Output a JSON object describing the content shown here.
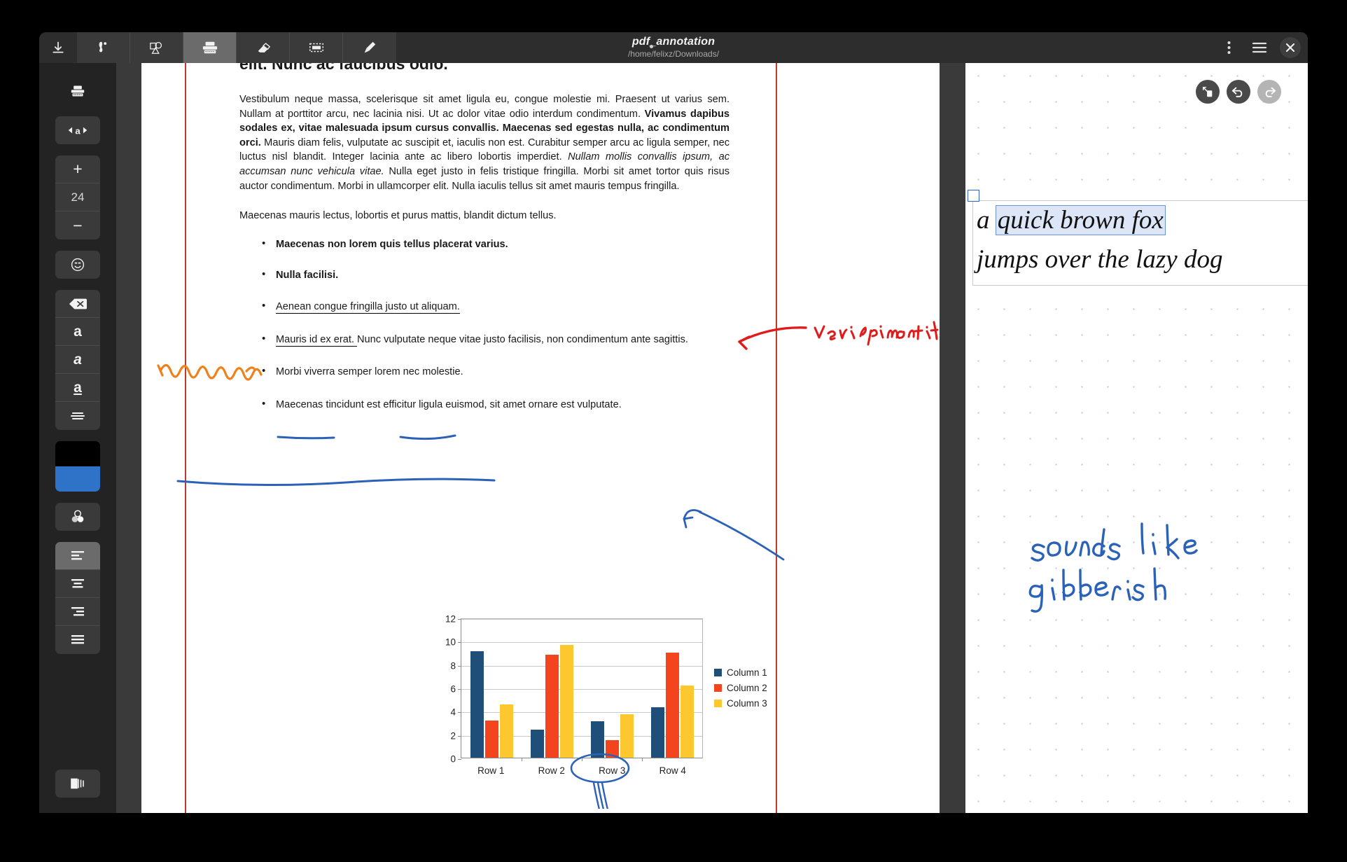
{
  "window": {
    "title": "pdf_annotation",
    "path": "/home/felixz/Downloads/",
    "modified_dot": "•"
  },
  "titlebar": {
    "download_icon": "download-icon",
    "tools": [
      {
        "name": "pen-tool",
        "icon": "pen-icon",
        "active": false
      },
      {
        "name": "shape-tool",
        "icon": "shape-icon",
        "active": false
      },
      {
        "name": "typewriter-tool",
        "icon": "typewriter-icon",
        "active": true
      },
      {
        "name": "eraser-tool",
        "icon": "eraser-icon",
        "active": false
      },
      {
        "name": "select-tool",
        "icon": "marquee-icon",
        "active": false
      },
      {
        "name": "highlighter-tool",
        "icon": "highlighter-icon",
        "active": false
      }
    ],
    "kebab_icon": "kebab-menu-icon",
    "hamburger_icon": "hamburger-menu-icon",
    "close_icon": "close-icon"
  },
  "sidebar": {
    "tool_icon": "typewriter-icon",
    "text_width_icon": "text-width-icon",
    "font_size": {
      "increase_label": "+",
      "value": "24",
      "decrease_label": "−"
    },
    "emoji_icon": "emoji-icon",
    "styles": [
      {
        "name": "clear-format",
        "icon": "backspace-icon",
        "label": ""
      },
      {
        "name": "bold",
        "icon": "bold-a-icon",
        "label": "a"
      },
      {
        "name": "italic",
        "icon": "italic-a-icon",
        "label": "a"
      },
      {
        "name": "underline",
        "icon": "underline-a-icon",
        "label": "a"
      },
      {
        "name": "strikethrough",
        "icon": "strikethrough-icon",
        "label": ""
      }
    ],
    "colors": {
      "primary": "#000000",
      "secondary": "#2f73c8"
    },
    "color_picker_icon": "color-circles-icon",
    "align": [
      {
        "name": "align-left",
        "icon": "align-left-icon",
        "active": true
      },
      {
        "name": "align-center",
        "icon": "align-center-icon",
        "active": false
      },
      {
        "name": "align-right",
        "icon": "align-right-icon",
        "active": false
      },
      {
        "name": "align-justify",
        "icon": "align-justify-icon",
        "active": false
      }
    ],
    "bottom_icon": "page-layout-icon"
  },
  "document": {
    "heading": "elit. Nunc ac faucibus odio.",
    "paragraph1_a": "Vestibulum neque massa, scelerisque sit amet ligula eu, congue molestie mi. Praesent ut varius sem. Nullam at porttitor arcu, nec lacinia nisi. Ut ac dolor vitae odio interdum condimentum. ",
    "paragraph1_bold": "Vivamus dapibus sodales ex, vitae malesuada ipsum cursus convallis. Maecenas sed egestas nulla, ac condimentum orci.",
    "paragraph1_b": " Mauris diam felis, vulputate ac suscipit et, iaculis non est. Curabitur semper arcu ac ligula semper, nec luctus nisl blandit. Integer lacinia ante ac libero lobortis imperdiet. ",
    "paragraph1_italic": "Nullam mollis convallis ipsum, ac accumsan nunc vehicula vitae.",
    "paragraph1_c": " Nulla eget justo in felis tristique fringilla. Morbi sit amet tortor quis risus auctor condimentum. Morbi in ullamcorper elit. Nulla iaculis tellus sit amet mauris tempus fringilla.",
    "paragraph2": "Maecenas mauris lectus, lobortis et purus mattis, blandit dictum tellus.",
    "bullets": [
      {
        "text": "Maecenas non lorem quis tellus placerat varius.",
        "style": "bold"
      },
      {
        "text": "Nulla facilisi.",
        "style": "bold-struck"
      },
      {
        "text": "Aenean congue fringilla justo ut aliquam. ",
        "style": "underline"
      },
      {
        "text_u": "Mauris id ex erat. ",
        "text_rest": "Nunc vulputate neque vitae justo facilisis, non condimentum ante sagittis.",
        "style": "mixed"
      },
      {
        "text": "Morbi viverra semper lorem nec molestie.",
        "style": "plain"
      },
      {
        "text": "Maecenas tincidunt est efficitur ligula euismod, sit amet ornare est vulputate.",
        "style": "plain"
      }
    ]
  },
  "chart_data": {
    "type": "bar",
    "title": "",
    "xlabel": "",
    "ylabel": "",
    "categories": [
      "Row 1",
      "Row 2",
      "Row 3",
      "Row 4"
    ],
    "series": [
      {
        "name": "Column 1",
        "color": "#1f4e79",
        "values": [
          9.1,
          2.4,
          3.1,
          4.3
        ]
      },
      {
        "name": "Column 2",
        "color": "#f4441e",
        "values": [
          3.2,
          8.8,
          1.5,
          9.0
        ]
      },
      {
        "name": "Column 3",
        "color": "#fdc82f",
        "values": [
          4.55,
          9.65,
          3.75,
          6.2
        ]
      }
    ],
    "ylim": [
      0,
      12
    ],
    "yticks": [
      0,
      2,
      4,
      6,
      8,
      10,
      12
    ],
    "grid": true,
    "legend_position": "right"
  },
  "annotations": {
    "red_note": "very important",
    "blue_note_line1": "sounds like",
    "blue_note_line2": "gibberish",
    "orange_scribble": "scribble-over-nulla-facilisi",
    "circle_row3": "circle-around-row-3",
    "red_arrow": "red-arrow-to-bullet",
    "blue_arrow": "blue-arrow-to-bullet"
  },
  "notepad": {
    "line1_pre": "a ",
    "line1_selected": "quick brown fox",
    "line2": "jumps over the lazy dog"
  },
  "float_buttons": [
    {
      "name": "fit-page-button",
      "icon": "fit-page-icon",
      "state": "normal"
    },
    {
      "name": "undo-button",
      "icon": "undo-icon",
      "state": "normal"
    },
    {
      "name": "redo-button",
      "icon": "redo-icon",
      "state": "disabled"
    }
  ]
}
